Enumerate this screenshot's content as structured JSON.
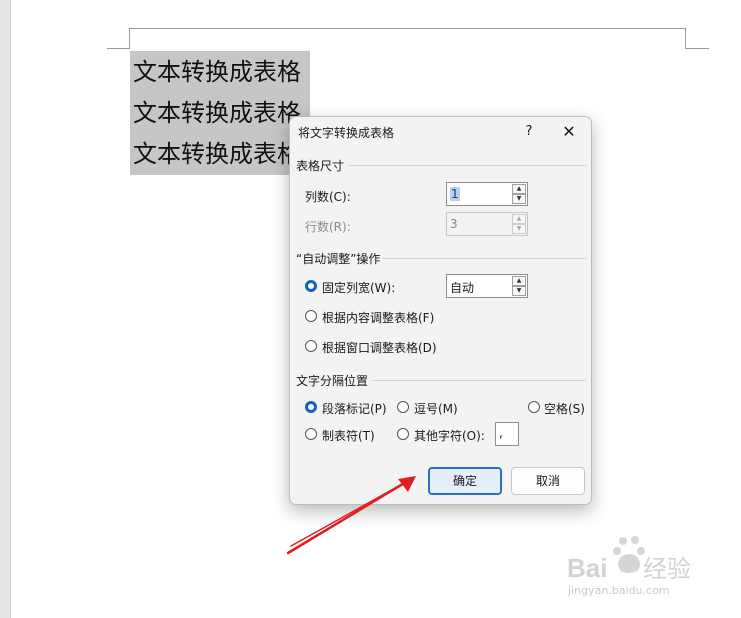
{
  "document": {
    "lines": [
      "文本转换成表格",
      "文本转换成表格",
      "文本转换成表格"
    ]
  },
  "dialog": {
    "title": "将文字转换成表格",
    "help_label": "?",
    "close_label": "✕",
    "table_size": {
      "heading": "表格尺寸",
      "columns_label": "列数(C):",
      "columns_value": "1",
      "rows_label": "行数(R):",
      "rows_value": "3"
    },
    "autofit": {
      "heading": "“自动调整”操作",
      "fixed_width_label": "固定列宽(W):",
      "fixed_width_value": "自动",
      "fit_content_label": "根据内容调整表格(F)",
      "fit_window_label": "根据窗口调整表格(D)",
      "selected": "fixed_width"
    },
    "separator": {
      "heading": "文字分隔位置",
      "paragraph_label": "段落标记(P)",
      "comma_label": "逗号(M)",
      "space_label": "空格(S)",
      "tab_label": "制表符(T)",
      "other_label": "其他字符(O):",
      "other_value": ",",
      "selected": "paragraph"
    },
    "ok_label": "确定",
    "cancel_label": "取消"
  },
  "watermark": {
    "text": "jingyan.baidu.com",
    "brand": "Bai经验"
  },
  "colors": {
    "accent": "#0f62c9",
    "arrow": "#e02020",
    "selection": "#c6c6c6"
  }
}
